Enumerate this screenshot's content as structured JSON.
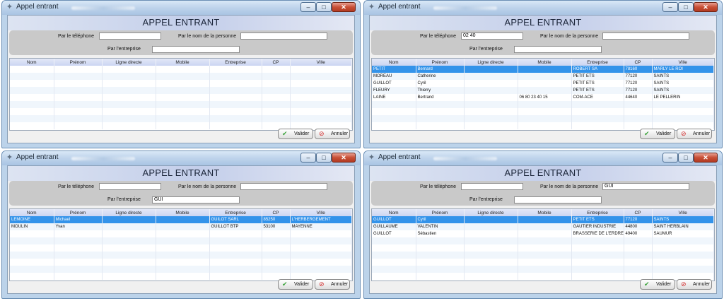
{
  "windows": [
    {
      "title": "Appel entrant",
      "heading": "APPEL ENTRANT",
      "filters": {
        "phone_label": "Par le téléphone",
        "phone_value": "",
        "person_label": "Par le nom de la personne",
        "person_value": "",
        "company_label": "Par l'entreprise",
        "company_value": ""
      },
      "columns": [
        "Nom",
        "Prénom",
        "Ligne directe",
        "Mobile",
        "Entreprise",
        "CP",
        "Ville"
      ],
      "rows": [],
      "selected_row": -1,
      "buttons": {
        "ok": "Valider",
        "cancel": "Annuler"
      }
    },
    {
      "title": "Appel entrant",
      "heading": "APPEL ENTRANT",
      "filters": {
        "phone_label": "Par le téléphone",
        "phone_value": "02 40",
        "person_label": "Par le nom de la personne",
        "person_value": "",
        "company_label": "Par l'entreprise",
        "company_value": ""
      },
      "columns": [
        "Nom",
        "Prénom",
        "Ligne directe",
        "Mobile",
        "Entreprise",
        "CP",
        "Ville"
      ],
      "rows": [
        [
          "PETIT",
          "Bernard",
          "",
          "",
          "ROBERT SA",
          "78160",
          "MARLY LE ROI"
        ],
        [
          "MOREAU",
          "Catherine",
          "",
          "",
          "PETIT ETS",
          "77120",
          "SAINTS"
        ],
        [
          "GUILLOT",
          "Cyril",
          "",
          "",
          "PETIT ETS",
          "77120",
          "SAINTS"
        ],
        [
          "FLEURY",
          "Thierry",
          "",
          "",
          "PETIT ETS",
          "77120",
          "SAINTS"
        ],
        [
          "LAINE",
          "Bertrand",
          "",
          "06 80 23 40 15",
          "COM-ACE",
          "44640",
          "LE PELLERIN"
        ]
      ],
      "selected_row": 0,
      "buttons": {
        "ok": "Valider",
        "cancel": "Annuler"
      }
    },
    {
      "title": "Appel entrant",
      "heading": "APPEL ENTRANT",
      "filters": {
        "phone_label": "Par le téléphone",
        "phone_value": "",
        "person_label": "Par le nom de la personne",
        "person_value": "",
        "company_label": "Par l'entreprise",
        "company_value": "GUI"
      },
      "columns": [
        "Nom",
        "Prénom",
        "Ligne directe",
        "Mobile",
        "Entreprise",
        "CP",
        "Ville"
      ],
      "rows": [
        [
          "LEMOINE",
          "Michael",
          "",
          "",
          "GUILOT SARL",
          "85250",
          "L'HERBERGEMENT"
        ],
        [
          "MOULIN",
          "Yvan",
          "",
          "",
          "GUILLOT BTP",
          "53100",
          "MAYENNE"
        ]
      ],
      "selected_row": 0,
      "buttons": {
        "ok": "Valider",
        "cancel": "Annuler"
      }
    },
    {
      "title": "Appel entrant",
      "heading": "APPEL ENTRANT",
      "filters": {
        "phone_label": "Par le téléphone",
        "phone_value": "",
        "person_label": "Par le nom de la personne",
        "person_value": "GUI",
        "company_label": "Par l'entreprise",
        "company_value": ""
      },
      "columns": [
        "Nom",
        "Prénom",
        "Ligne directe",
        "Mobile",
        "Entreprise",
        "CP",
        "Ville"
      ],
      "rows": [
        [
          "GUILLOT",
          "Cyril",
          "",
          "",
          "PETIT ETS",
          "77120",
          "SAINTS"
        ],
        [
          "GUILLAUME",
          "VALENTIN",
          "",
          "",
          "GAUTIER INDUSTRIE",
          "44800",
          "SAINT HERBLAIN"
        ],
        [
          "GUILLOT",
          "Sébastien",
          "",
          "",
          "BRASSERIE DE L'ERDRE",
          "49400",
          "SAUMUR"
        ]
      ],
      "selected_row": 0,
      "buttons": {
        "ok": "Valider",
        "cancel": "Annuler"
      }
    }
  ],
  "icons": {
    "app": "app-icon",
    "minimize": "minimize-icon",
    "maximize": "maximize-icon",
    "close": "close-icon",
    "ok": "check-icon",
    "cancel": "cancel-icon"
  },
  "colors": {
    "selection": "#3393ea",
    "close_button": "#c84f36",
    "filter_panel": "#c9c9c9",
    "frame": "#bcd3ea"
  }
}
